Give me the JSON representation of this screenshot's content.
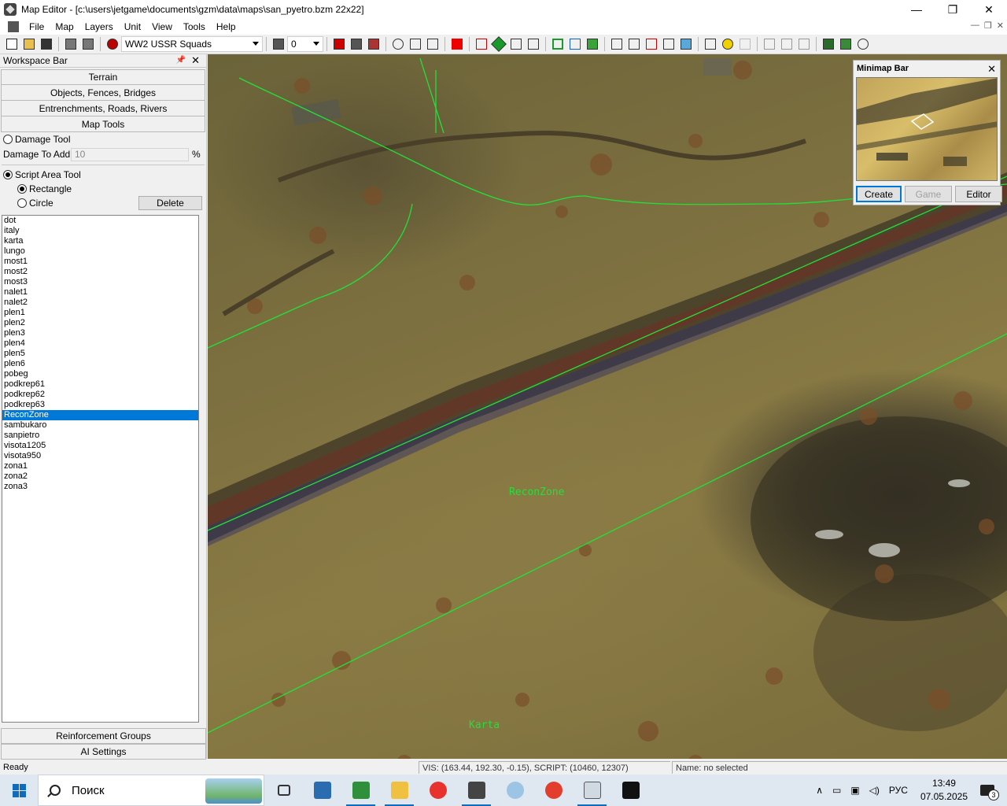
{
  "window": {
    "title": "Map Editor - [c:\\users\\jetgame\\documents\\gzm\\data\\maps\\san_pyetro.bzm  22x22]",
    "minimize": "—",
    "maximize": "❐",
    "close": "✕"
  },
  "menu": {
    "items": [
      "File",
      "Map",
      "Layers",
      "Unit",
      "View",
      "Tools",
      "Help"
    ],
    "mdi_minimize": "—",
    "mdi_restore": "❐",
    "mdi_close": "✕"
  },
  "toolbar": {
    "squad_combo": "WW2 USSR Squads",
    "player_combo": "0",
    "icons": [
      "new-icon",
      "open-icon",
      "save-icon",
      "vehicle-icon",
      "vehicle2-icon",
      "squad-icon",
      "player-icon",
      "red-block-icon",
      "tower-icon",
      "soldier-icon",
      "refresh-icon",
      "house-icon",
      "house2-icon",
      "medic-icon",
      "ai-icon",
      "diamond-icon",
      "grid-icon",
      "mirror-icon",
      "square-icon",
      "path-icon",
      "brush-icon",
      "bridge-icon",
      "tree-icon",
      "cube-icon",
      "tree2-icon",
      "water-icon",
      "forest-icon",
      "radiation-icon",
      "arrow-icon",
      "artillery-icon",
      "artillery2-icon",
      "artillery3-icon",
      "minimap-icon",
      "map-icon",
      "bug-icon"
    ]
  },
  "workspace": {
    "title": "Workspace Bar",
    "sections_top": [
      "Terrain",
      "Objects, Fences, Bridges",
      "Entrenchments, Roads, Rivers",
      "Map Tools"
    ],
    "damage_tool_label": "Damage Tool",
    "damage_to_add_label": "Damage To Add:",
    "damage_to_add_value": "10",
    "damage_percent": "%",
    "script_area_label": "Script Area Tool",
    "rectangle_label": "Rectangle",
    "circle_label": "Circle",
    "delete_label": "Delete",
    "areas": [
      "dot",
      "italy",
      "karta",
      "lungo",
      "most1",
      "most2",
      "most3",
      "nalet1",
      "nalet2",
      "plen1",
      "plen2",
      "plen3",
      "plen4",
      "plen5",
      "plen6",
      "pobeg",
      "podkrep61",
      "podkrep62",
      "podkrep63",
      "ReconZone",
      "sambukaro",
      "sanpietro",
      "visota1205",
      "visota950",
      "zona1",
      "zona2",
      "zona3"
    ],
    "selected_area": "ReconZone",
    "sections_bottom": [
      "Reinforcement Groups",
      "AI Settings"
    ]
  },
  "map": {
    "label_recon": "ReconZone",
    "label_karta": "Karta"
  },
  "minimap": {
    "title": "Minimap Bar",
    "create": "Create",
    "game": "Game",
    "editor": "Editor"
  },
  "status": {
    "ready": "Ready",
    "coords": "VIS: (163.44, 192.30, -0.15), SCRIPT: (10460, 12307)",
    "name": "Name: no selected"
  },
  "taskbar": {
    "search_placeholder": "Поиск",
    "language": "РУС",
    "time": "13:49",
    "date": "07.05.2025",
    "notifications": "3",
    "apps": [
      "task-view-icon",
      "news-icon",
      "excel-icon",
      "explorer-icon",
      "yandex-icon",
      "map-editor-icon",
      "paint-icon",
      "wps-icon",
      "app-window-icon",
      "7zip-icon"
    ]
  },
  "colors": {
    "selection": "#0078d7",
    "script_area_lines": "#22e03a"
  }
}
